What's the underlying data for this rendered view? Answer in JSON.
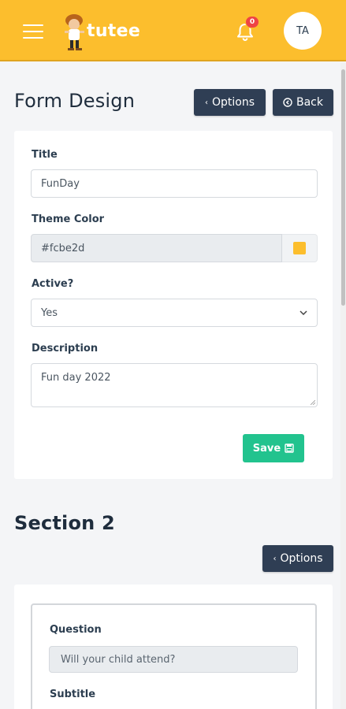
{
  "header": {
    "logo_text": "tutee",
    "notification_count": "0",
    "avatar_initials": "TA",
    "brand_color": "#fcbe2d"
  },
  "page": {
    "title": "Form Design",
    "options_label": "Options",
    "back_label": "Back"
  },
  "form": {
    "title_label": "Title",
    "title_value": "FunDay",
    "theme_color_label": "Theme Color",
    "theme_color_value": "#fcbe2d",
    "active_label": "Active?",
    "active_value": "Yes",
    "description_label": "Description",
    "description_value": "Fun day 2022",
    "save_label": "Save"
  },
  "section": {
    "title": "Section 2",
    "options_label": "Options",
    "question_label": "Question",
    "question_value": "Will your child attend?",
    "subtitle_label": "Subtitle"
  },
  "colors": {
    "accent": "#fcbe2d",
    "dark_button": "#2f3e54",
    "save_button": "#22c38e",
    "badge": "#ef4444"
  },
  "icons": [
    "menu-icon",
    "bell-icon",
    "chevron-left-icon",
    "back-circle-icon",
    "chevron-down-icon",
    "save-icon"
  ]
}
